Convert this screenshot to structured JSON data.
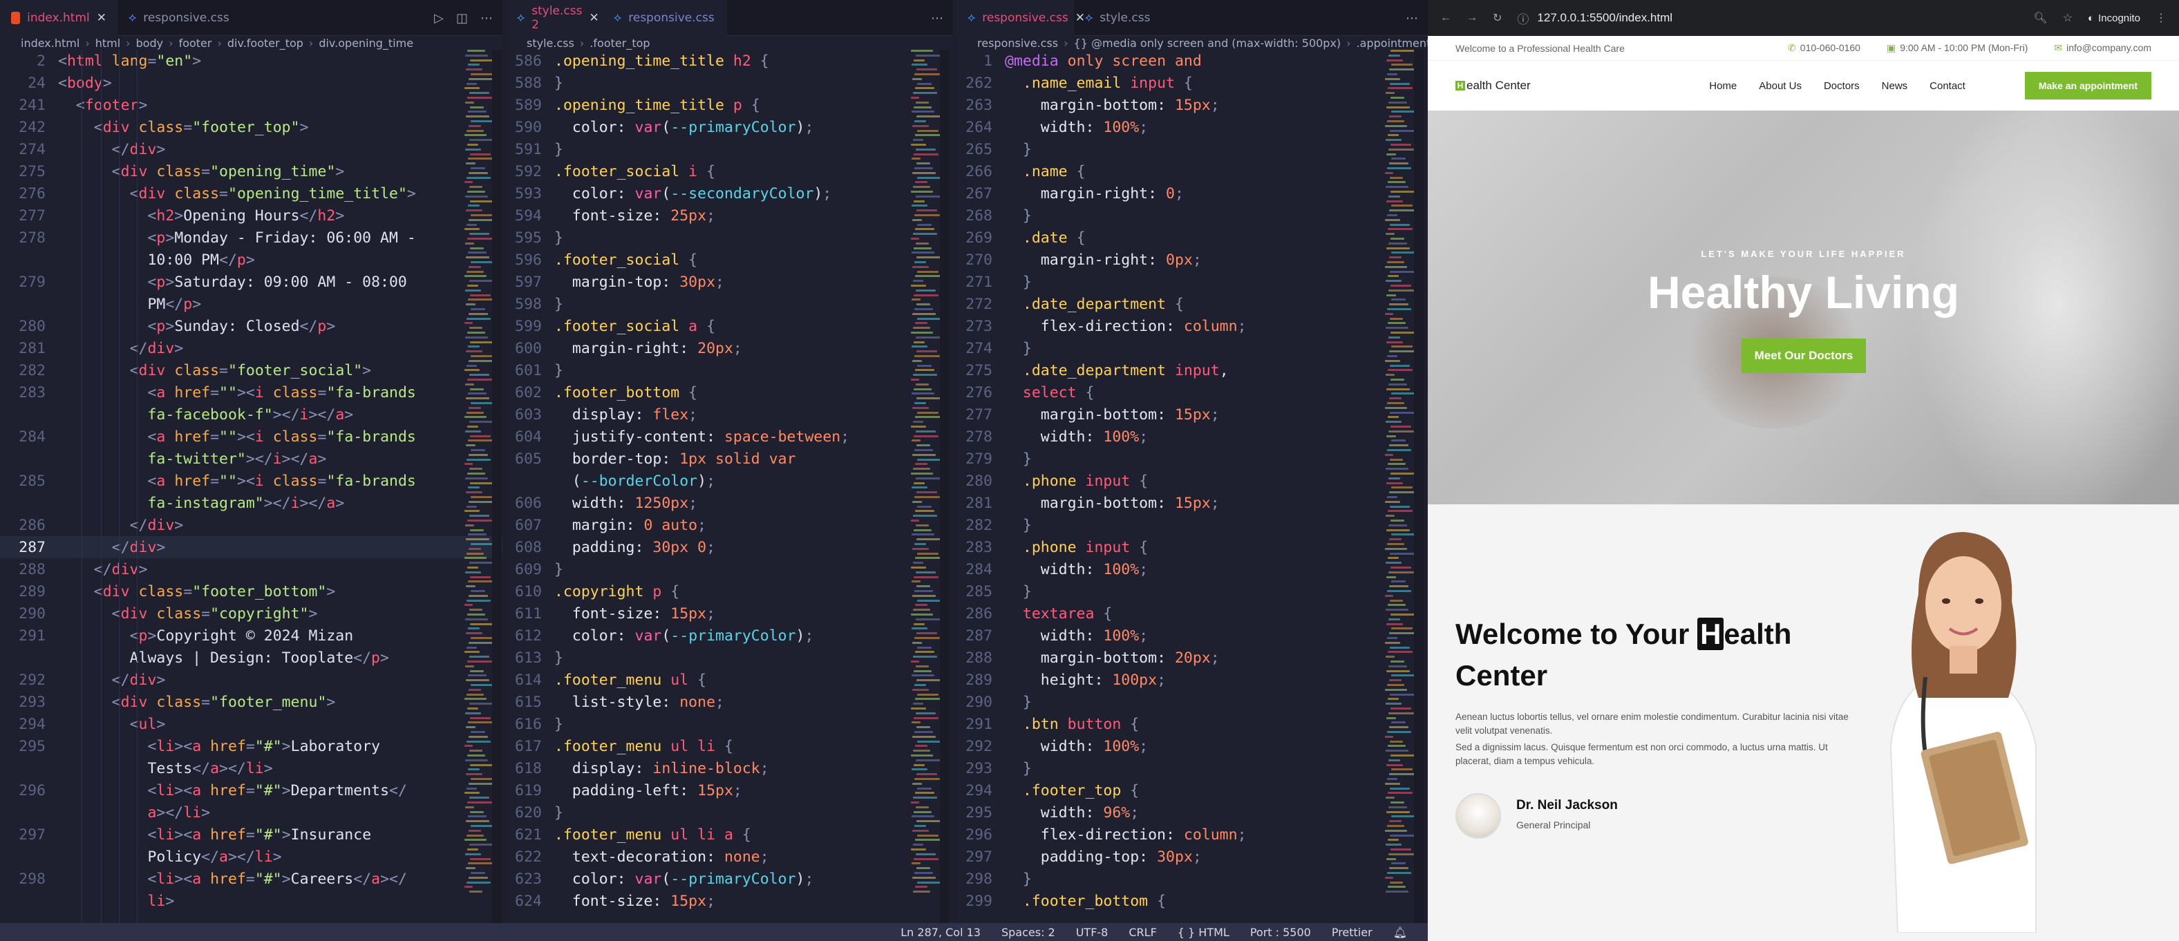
{
  "editor1": {
    "tabs": [
      {
        "label": "index.html",
        "active": true
      },
      {
        "label": "responsive.css",
        "active": false
      }
    ],
    "crumbs": [
      "index.html",
      "html",
      "body",
      "footer",
      "div.footer_top",
      "div.opening_time"
    ]
  },
  "editor2": {
    "tabs": [
      {
        "label": "style.css 2",
        "active": true
      },
      {
        "label": "responsive.css",
        "active": false
      }
    ],
    "crumbs": [
      "style.css",
      ".footer_top"
    ]
  },
  "editor3": {
    "tabs": [
      {
        "label": "responsive.css",
        "active": true
      },
      {
        "label": "style.css",
        "active": false
      }
    ],
    "crumbs": [
      "responsive.css",
      "{} @media only screen and (max-width: 500px)",
      ".appointment"
    ]
  },
  "status": {
    "position": "Ln 287, Col 13",
    "spaces": "Spaces: 2",
    "encoding": "UTF-8",
    "eol": "CRLF",
    "language": "{ } HTML",
    "port": "Port : 5500",
    "formatter": "Prettier"
  },
  "browser": {
    "url": "127.0.0.1:5500/index.html",
    "mode": "Incognito",
    "topbar": {
      "welcome": "Welcome to a Professional Health Care",
      "phone": "010-060-0160",
      "hours": "9:00 AM - 10:00 PM (Mon-Fri)",
      "email": "info@company.com"
    },
    "nav": {
      "logo_letter": "H",
      "logo_rest": "ealth Center",
      "items": [
        "Home",
        "About Us",
        "Doctors",
        "News",
        "Contact"
      ],
      "cta": "Make an appointment"
    },
    "hero": {
      "subtitle": "LET'S MAKE YOUR LIFE HAPPIER",
      "title": "Healthy Living",
      "button": "Meet Our Doctors"
    },
    "about": {
      "title_pre": "Welcome to Your ",
      "title_h": "H",
      "title_post": "ealth Center",
      "p1": "Aenean luctus lobortis tellus, vel ornare enim molestie condimentum. Curabitur lacinia nisi vitae velit volutpat venenatis.",
      "p2": "Sed a dignissim lacus. Quisque fermentum est non orci commodo, a luctus urna mattis. Ut placerat, diam a tempus vehicula.",
      "doctor_name": "Dr. Neil Jackson",
      "doctor_role": "General Principal"
    }
  },
  "colors": {
    "accent_green": "#7dbb2e",
    "editor_bg": "#1e2030",
    "tag": "#ff5c7a",
    "string": "#b8e986"
  }
}
